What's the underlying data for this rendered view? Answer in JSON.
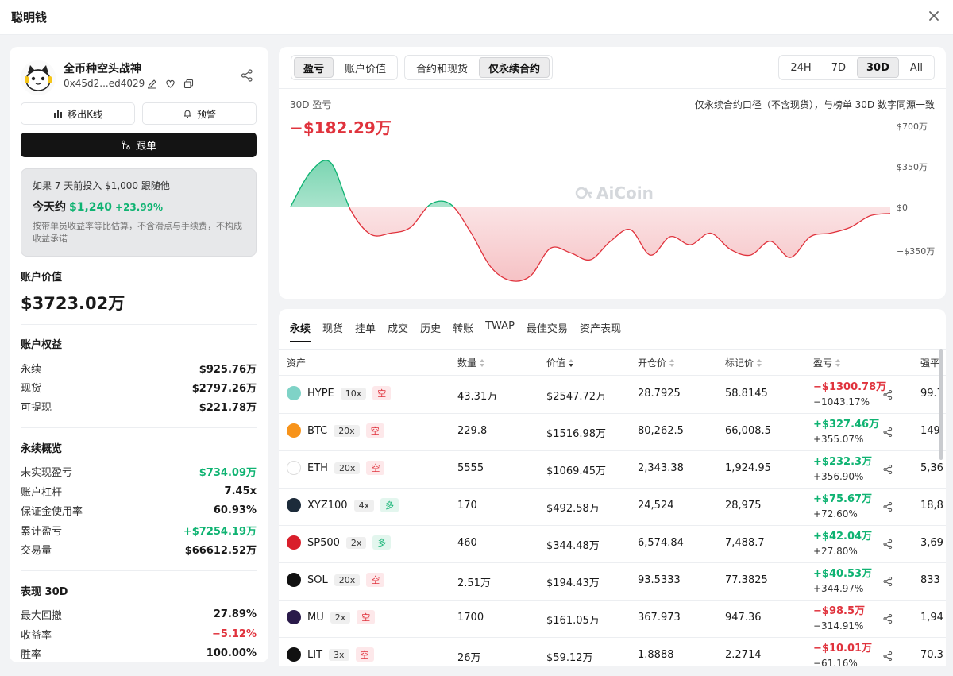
{
  "window": {
    "title": "聪明钱"
  },
  "profile": {
    "name": "全币种空头战神",
    "address": "0x45d2...ed4029",
    "kline_btn": "移出K线",
    "alert_btn": "预警",
    "follow_btn": "跟单"
  },
  "simulation": {
    "line1": "如果 7 天前投入 $1,000 跟随他",
    "prefix": "今天约",
    "amount": "$1,240",
    "pct": "+23.99%",
    "note": "按带单员收益率等比估算，不含滑点与手续费，不构成收益承诺"
  },
  "account": {
    "label": "账户价值",
    "value": "$3723.02万"
  },
  "equity": {
    "title": "账户权益",
    "rows": [
      {
        "k": "永续",
        "v": "$925.76万"
      },
      {
        "k": "现货",
        "v": "$2797.26万"
      },
      {
        "k": "可提现",
        "v": "$221.78万"
      }
    ]
  },
  "perp": {
    "title": "永续概览",
    "rows": [
      {
        "k": "未实现盈亏",
        "v": "$734.09万"
      },
      {
        "k": "账户杠杆",
        "v": "7.45x"
      },
      {
        "k": "保证金使用率",
        "v": "60.93%"
      },
      {
        "k": "累计盈亏",
        "v": "+$7254.19万"
      },
      {
        "k": "交易量",
        "v": "$66612.52万"
      }
    ]
  },
  "perf": {
    "title": "表现 30D",
    "rows": [
      {
        "k": "最大回撤",
        "v": "27.89%"
      },
      {
        "k": "收益率",
        "v": "−5.12%"
      },
      {
        "k": "胜率",
        "v": "100.00%"
      }
    ]
  },
  "chart": {
    "metric_tabs": [
      "盈亏",
      "账户价值"
    ],
    "scope_tabs": [
      "合约和现货",
      "仅永续合约"
    ],
    "range_tabs": [
      "24H",
      "7D",
      "30D",
      "All"
    ],
    "subtitle": "30D 盈亏",
    "value": "−$182.29万",
    "note": "仅永续合约口径（不含现货），与榜单 30D 数字同源一致",
    "watermark": "AiCoin",
    "ylabels": [
      "$700万",
      "$350万",
      "$0",
      "−$350万"
    ],
    "colors": {
      "positive": "#0fb372",
      "negative": "#e0333d"
    }
  },
  "chart_data": {
    "type": "area",
    "title": "30D 盈亏",
    "x": [
      0,
      1,
      2,
      3,
      4,
      5,
      6,
      7,
      8,
      9,
      10,
      11,
      12,
      13,
      14,
      15,
      16,
      17,
      18,
      19,
      20,
      21,
      22,
      23,
      24,
      25,
      26,
      27,
      28,
      29,
      30
    ],
    "values": [
      0,
      300,
      380,
      -30,
      -240,
      -230,
      -180,
      20,
      20,
      -220,
      -520,
      -640,
      -600,
      -360,
      -400,
      -460,
      -300,
      -200,
      -420,
      -260,
      -330,
      -230,
      -370,
      -420,
      -300,
      -440,
      -260,
      -230,
      -180,
      -80,
      -60
    ],
    "ylim": [
      -700,
      700
    ],
    "yticks": [
      "$700万",
      "$350万",
      "$0",
      "−$350万"
    ],
    "grid": false
  },
  "table": {
    "tabs": [
      "永续",
      "现货",
      "挂单",
      "成交",
      "历史",
      "转账",
      "TWAP",
      "最佳交易",
      "资产表现"
    ],
    "headers": [
      "资产",
      "数量",
      "价值",
      "开仓价",
      "标记价",
      "盈亏",
      "强平"
    ],
    "rows": [
      {
        "sym": "HYPE",
        "lev": "10x",
        "side": "空",
        "qty": "43.31万",
        "value": "$2547.72万",
        "entry": "28.7925",
        "mark": "58.8145",
        "pnl": "−$1300.78万",
        "pct": "−1043.17%",
        "liq": "99.7",
        "sign": "neg",
        "color": "#7fd3c7"
      },
      {
        "sym": "BTC",
        "lev": "20x",
        "side": "空",
        "qty": "229.8",
        "value": "$1516.98万",
        "entry": "80,262.5",
        "mark": "66,008.5",
        "pnl": "+$327.46万",
        "pct": "+355.07%",
        "liq": "149,",
        "sign": "pos",
        "color": "#f7931a"
      },
      {
        "sym": "ETH",
        "lev": "20x",
        "side": "空",
        "qty": "5555",
        "value": "$1069.45万",
        "entry": "2,343.38",
        "mark": "1,924.95",
        "pnl": "+$232.3万",
        "pct": "+356.90%",
        "liq": "5,36",
        "sign": "pos",
        "color": "#ffffff"
      },
      {
        "sym": "XYZ100",
        "lev": "4x",
        "side": "多",
        "qty": "170",
        "value": "$492.58万",
        "entry": "24,524",
        "mark": "28,975",
        "pnl": "+$75.67万",
        "pct": "+72.60%",
        "liq": "18,8",
        "sign": "pos",
        "color": "#1c2b3a"
      },
      {
        "sym": "SP500",
        "lev": "2x",
        "side": "多",
        "qty": "460",
        "value": "$344.48万",
        "entry": "6,574.84",
        "mark": "7,488.7",
        "pnl": "+$42.04万",
        "pct": "+27.80%",
        "liq": "3,69",
        "sign": "pos",
        "color": "#d91f2b"
      },
      {
        "sym": "SOL",
        "lev": "20x",
        "side": "空",
        "qty": "2.51万",
        "value": "$194.43万",
        "entry": "93.5333",
        "mark": "77.3825",
        "pnl": "+$40.53万",
        "pct": "+344.97%",
        "liq": "833",
        "sign": "pos",
        "color": "#111111"
      },
      {
        "sym": "MU",
        "lev": "2x",
        "side": "空",
        "qty": "1700",
        "value": "$161.05万",
        "entry": "367.973",
        "mark": "947.36",
        "pnl": "−$98.5万",
        "pct": "−314.91%",
        "liq": "1,94",
        "sign": "neg",
        "color": "#2a1a4a"
      },
      {
        "sym": "LIT",
        "lev": "3x",
        "side": "空",
        "qty": "26万",
        "value": "$59.12万",
        "entry": "1.8888",
        "mark": "2.2714",
        "pnl": "−$10.01万",
        "pct": "−61.16%",
        "liq": "70.3",
        "sign": "neg",
        "color": "#111111"
      }
    ]
  }
}
